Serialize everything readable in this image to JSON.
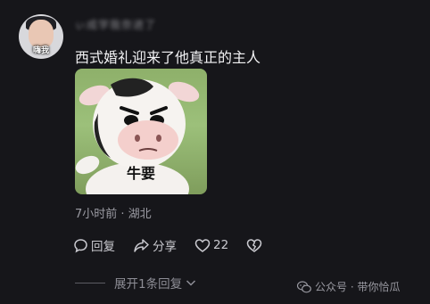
{
  "comment": {
    "avatar_tag": "嗨我",
    "username": "ぃ成学我奈进了",
    "text": "西式婚礼迎来了他真正的主人",
    "sticker_caption": "牛要",
    "meta": "7小时前 · 湖北"
  },
  "actions": {
    "reply_label": "回复",
    "share_label": "分享",
    "like_count": "22"
  },
  "replies": {
    "expand_label": "展开1条回复"
  },
  "watermark": {
    "text": "公众号 · 带你恰瓜"
  },
  "colors": {
    "background": "#16161a",
    "text_primary": "#f2f2f4",
    "text_secondary": "#9b9ba3"
  },
  "icons": [
    "reply-icon",
    "share-icon",
    "heart-icon",
    "broken-heart-icon",
    "chevron-down-icon",
    "wechat-icon"
  ]
}
